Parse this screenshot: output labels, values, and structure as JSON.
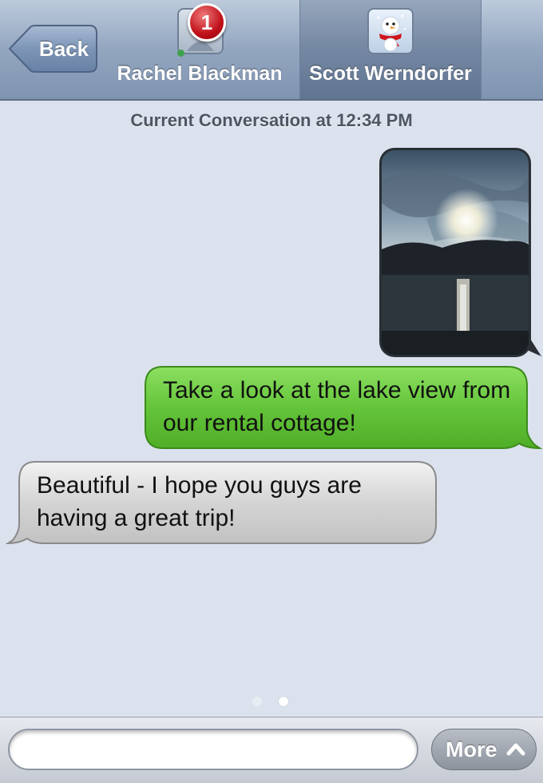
{
  "header": {
    "back_label": "Back",
    "contacts": [
      {
        "name": "Rachel Blackman",
        "badge": "1",
        "selected": false,
        "avatar_icon": "contact-avatar-generic-icon"
      },
      {
        "name": "Scott Werndorfer",
        "selected": true,
        "avatar_icon": "snowman-avatar-icon"
      }
    ]
  },
  "conversation": {
    "timestamp": "Current Conversation at 12:34 PM",
    "messages": [
      {
        "direction": "outgoing",
        "type": "photo",
        "description": "lake-sunset-photo"
      },
      {
        "direction": "outgoing",
        "type": "text",
        "text": "Take a look at the lake view from our rental cottage!",
        "color": "#64c43a"
      },
      {
        "direction": "incoming",
        "type": "text",
        "text": "Beautiful - I hope you guys are having a great trip!",
        "color": "#d4d4d4"
      }
    ]
  },
  "pager": {
    "pages": 2,
    "current": 2
  },
  "input_bar": {
    "field_value": "",
    "more_label": "More",
    "more_icon": "chevron-up-icon"
  },
  "colors": {
    "background": "#dbe2ee",
    "header": "#93a6c0",
    "outgoing_bubble": "#64c43a",
    "incoming_bubble": "#d4d4d4",
    "badge": "#c0101a"
  }
}
